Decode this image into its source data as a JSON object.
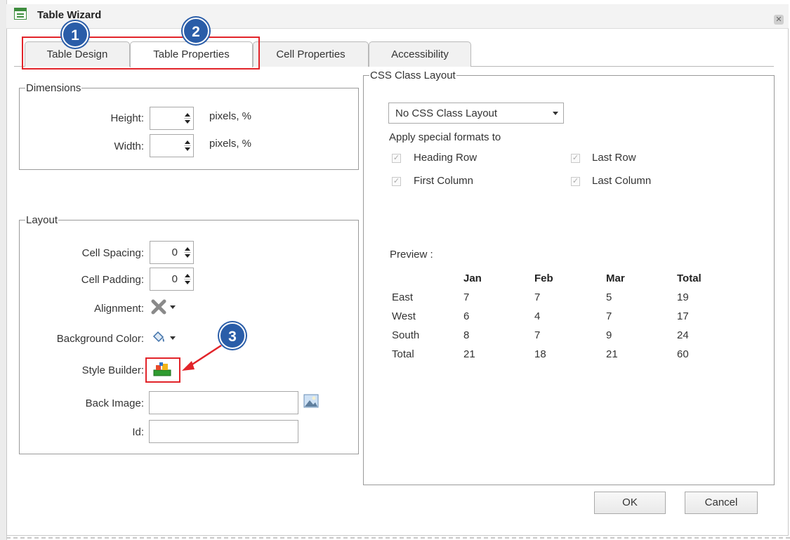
{
  "window": {
    "title": "Table Wizard",
    "close": "✕"
  },
  "tabs": [
    "Table Design",
    "Table Properties",
    "Cell Properties",
    "Accessibility"
  ],
  "badges": [
    "1",
    "2",
    "3"
  ],
  "dimensions": {
    "legend": "Dimensions",
    "height_label": "Height:",
    "width_label": "Width:",
    "height_units": "pixels, %",
    "width_units": "pixels, %"
  },
  "layout": {
    "legend": "Layout",
    "cell_spacing_label": "Cell Spacing:",
    "cell_spacing_value": "0",
    "cell_padding_label": "Cell Padding:",
    "cell_padding_value": "0",
    "alignment_label": "Alignment:",
    "bgcolor_label": "Background Color:",
    "style_builder_label": "Style Builder:",
    "back_image_label": "Back Image:",
    "id_label": "Id:"
  },
  "css_layout": {
    "legend": "CSS Class Layout",
    "selected": "No CSS Class Layout",
    "apply_label": "Apply special formats to",
    "heading_row": "Heading Row",
    "last_row": "Last Row",
    "first_column": "First Column",
    "last_column": "Last Column",
    "preview_label": "Preview :"
  },
  "preview_table": {
    "headers": [
      "",
      "Jan",
      "Feb",
      "Mar",
      "Total"
    ],
    "rows": [
      [
        "East",
        "7",
        "7",
        "5",
        "19"
      ],
      [
        "West",
        "6",
        "4",
        "7",
        "17"
      ],
      [
        "South",
        "8",
        "7",
        "9",
        "24"
      ],
      [
        "Total",
        "21",
        "18",
        "21",
        "60"
      ]
    ]
  },
  "buttons": {
    "ok": "OK",
    "cancel": "Cancel"
  },
  "colors": {
    "accent_badge": "#2a5da8",
    "highlight": "#e2242a"
  }
}
